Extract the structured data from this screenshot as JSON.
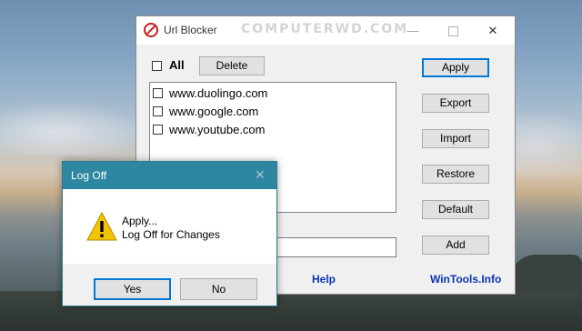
{
  "main_window": {
    "title": "Url Blocker",
    "watermark": "COMPUTERWD.COM",
    "window_controls": {
      "minimize": "—",
      "close": "✕"
    },
    "all_label": "All",
    "delete_label": "Delete",
    "url_list": [
      {
        "url": "www.duolingo.com",
        "checked": false
      },
      {
        "url": "www.google.com",
        "checked": false
      },
      {
        "url": "www.youtube.com",
        "checked": false
      }
    ],
    "url_input_value": "",
    "buttons": {
      "apply": "Apply",
      "export": "Export",
      "import": "Import",
      "restore": "Restore",
      "default": "Default",
      "add": "Add"
    },
    "links": {
      "help": "Help",
      "wintools": "WinTools.Info"
    }
  },
  "dialog": {
    "title": "Log Off",
    "close_glyph": "✕",
    "message_line1": "Apply...",
    "message_line2": "Log Off for Changes",
    "yes_label": "Yes",
    "no_label": "No"
  },
  "colors": {
    "dialog_titlebar": "#2e87a1",
    "link": "#0b34b3",
    "focus_border": "#0078d7",
    "app_icon": "#c81e1e",
    "warning_yellow": "#f5c400"
  },
  "icons": {
    "app": "no-entry-icon",
    "warning": "warning-icon"
  }
}
